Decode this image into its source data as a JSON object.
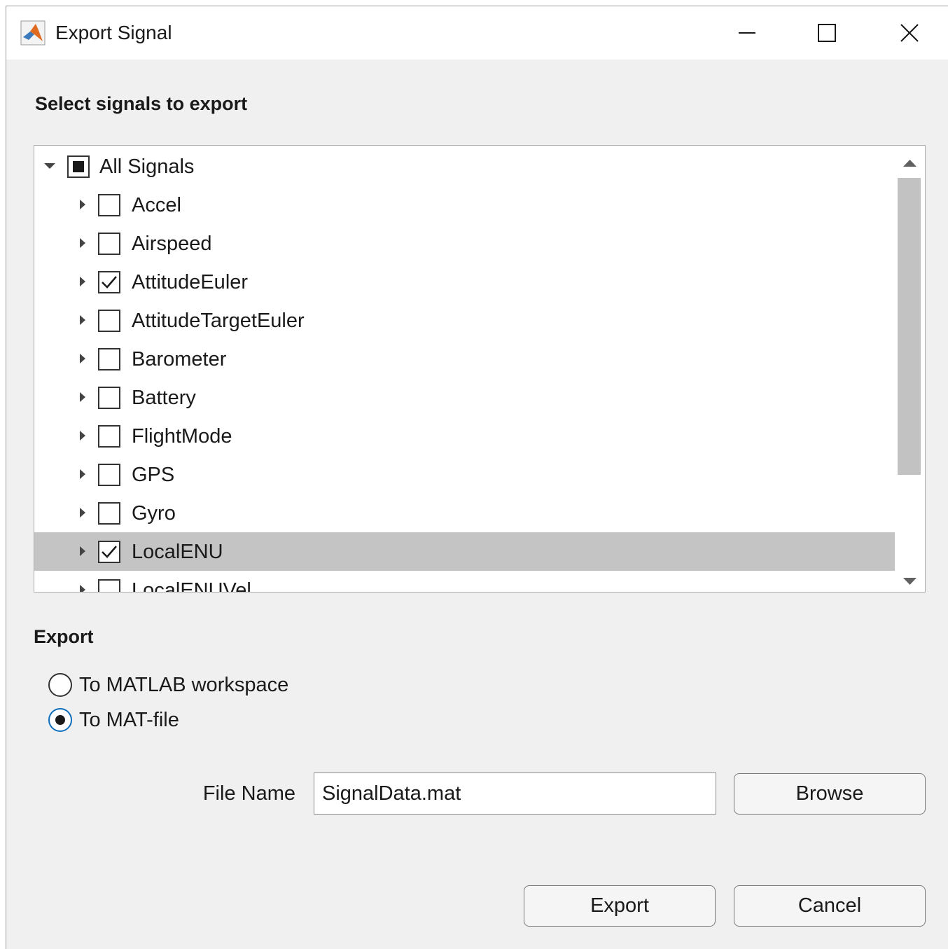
{
  "window": {
    "title": "Export Signal",
    "icon": "matlab-logo-icon"
  },
  "signals_heading": "Select signals to export",
  "tree": {
    "root": {
      "label": "All Signals",
      "expanded": true,
      "state": "partial"
    },
    "items": [
      {
        "label": "Accel",
        "checked": false,
        "selected": false
      },
      {
        "label": "Airspeed",
        "checked": false,
        "selected": false
      },
      {
        "label": "AttitudeEuler",
        "checked": true,
        "selected": false
      },
      {
        "label": "AttitudeTargetEuler",
        "checked": false,
        "selected": false
      },
      {
        "label": "Barometer",
        "checked": false,
        "selected": false
      },
      {
        "label": "Battery",
        "checked": false,
        "selected": false
      },
      {
        "label": "FlightMode",
        "checked": false,
        "selected": false
      },
      {
        "label": "GPS",
        "checked": false,
        "selected": false
      },
      {
        "label": "Gyro",
        "checked": false,
        "selected": false
      },
      {
        "label": "LocalENU",
        "checked": true,
        "selected": true
      },
      {
        "label": "LocalENUVel",
        "checked": false,
        "selected": false
      }
    ]
  },
  "export": {
    "heading": "Export",
    "options": [
      {
        "label": "To MATLAB workspace",
        "checked": false
      },
      {
        "label": "To MAT-file",
        "checked": true
      }
    ],
    "file_name_label": "File Name",
    "file_name_value": "SignalData.mat",
    "browse_label": "Browse"
  },
  "actions": {
    "export_label": "Export",
    "cancel_label": "Cancel"
  },
  "colors": {
    "dialog_bg": "#f0f0f0",
    "selected_row": "#c4c4c4",
    "radio_focus": "#0c6ebd"
  }
}
